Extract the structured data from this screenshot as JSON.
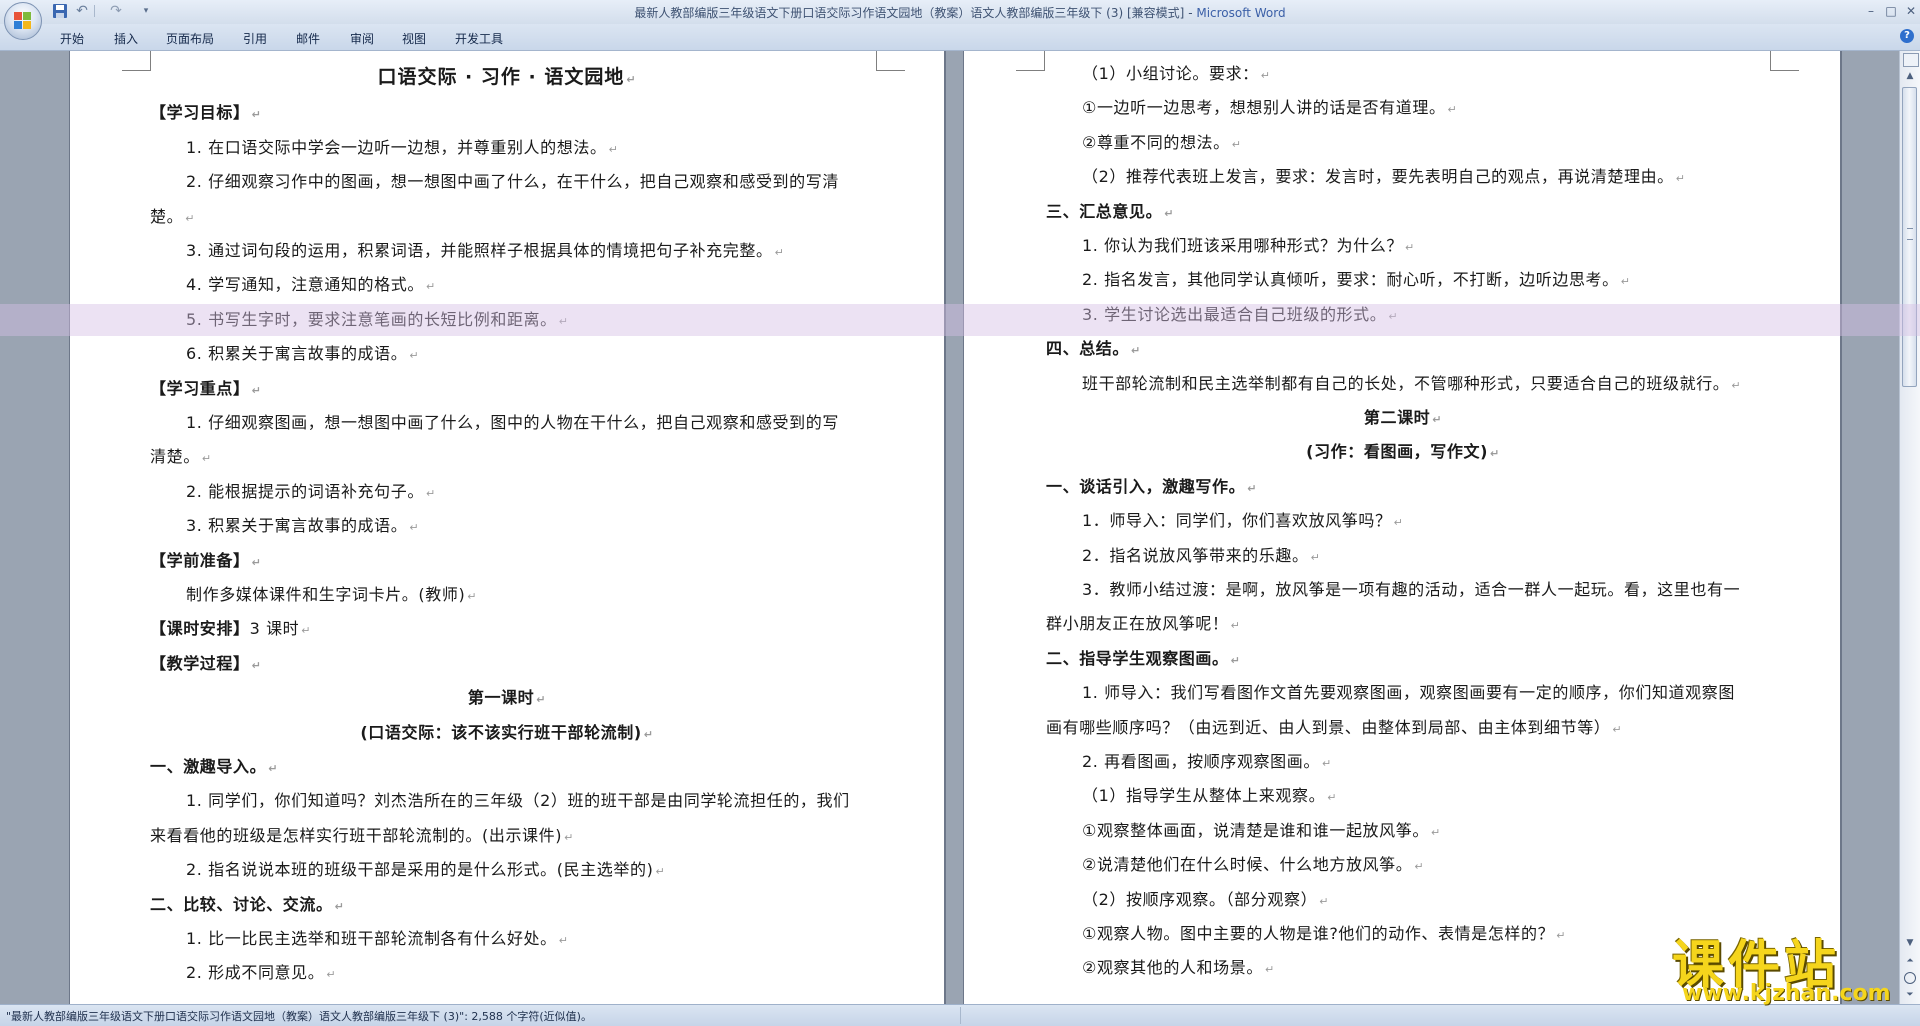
{
  "window": {
    "title": "最新人教部编版三年级语文下册口语交际习作语文园地（教案）语文人教部编版三年级下 (3) [兼容模式]",
    "app_name": "Microsoft Word"
  },
  "quick_access": {
    "save_icon": "save-icon",
    "undo_icon": "undo-icon",
    "redo_icon": "redo-icon",
    "customize_icon": "dropdown-arrow-icon"
  },
  "ribbon_tabs": [
    "开始",
    "插入",
    "页面布局",
    "引用",
    "邮件",
    "审阅",
    "视图",
    "开发工具"
  ],
  "colors": {
    "titlebar": "#dbe5f2",
    "title_app": "#3a5fa7",
    "page_bg": "#ffffff",
    "workspace": "#9aa4b2",
    "watermark": "#f5d51c"
  },
  "left_page": [
    {
      "t": "口语交际 · 习作 · 语文园地",
      "pm": "↵",
      "s": "title"
    },
    {
      "t": "【学习目标】",
      "pm": "↵",
      "s": "bold"
    },
    {
      "t": "1. 在口语交际中学会一边听一边想，并尊重别人的想法。",
      "pm": "↵",
      "s": "ind"
    },
    {
      "t": "2. 仔细观察习作中的图画，想一想图中画了什么，在干什么，把自己观察和感受到的写清",
      "pm": "",
      "s": "ind"
    },
    {
      "t": "楚。",
      "pm": "↵",
      "s": "plain"
    },
    {
      "t": "3. 通过词句段的运用，积累词语，并能照样子根据具体的情境把句子补充完整。",
      "pm": "↵",
      "s": "ind"
    },
    {
      "t": "4. 学写通知，注意通知的格式。",
      "pm": "↵",
      "s": "ind"
    },
    {
      "t": "5. 书写生字时，要求注意笔画的长短比例和距离。",
      "pm": "↵",
      "s": "ind"
    },
    {
      "t": "6. 积累关于寓言故事的成语。",
      "pm": "↵",
      "s": "ind"
    },
    {
      "t": "【学习重点】",
      "pm": "↵",
      "s": "bold"
    },
    {
      "t": "1. 仔细观察图画，想一想图中画了什么，图中的人物在干什么，把自己观察和感受到的写",
      "pm": "",
      "s": "ind"
    },
    {
      "t": "清楚。",
      "pm": "↵",
      "s": "plain"
    },
    {
      "t": "2. 能根据提示的词语补充句子。",
      "pm": "↵",
      "s": "ind"
    },
    {
      "t": "3. 积累关于寓言故事的成语。",
      "pm": "↵",
      "s": "ind"
    },
    {
      "t": "【学前准备】",
      "pm": "↵",
      "s": "bold"
    },
    {
      "t": "制作多媒体课件和生字词卡片。(教师)",
      "pm": "↵",
      "s": "ind"
    },
    {
      "t": "【课时安排】",
      "t2": "3 课时",
      "pm": "↵",
      "s": "mixed"
    },
    {
      "t": "【教学过程】",
      "pm": "↵",
      "s": "bold"
    },
    {
      "t": "第一课时",
      "pm": "↵",
      "s": "center-bold"
    },
    {
      "t": "(口语交际：该不该实行班干部轮流制)",
      "pm": "↵",
      "s": "center-bold"
    },
    {
      "t": "一、激趣导入。",
      "pm": "↵",
      "s": "bold"
    },
    {
      "t": "1. 同学们，你们知道吗？刘杰浩所在的三年级（2）班的班干部是由同学轮流担任的，我们",
      "pm": "",
      "s": "ind"
    },
    {
      "t": "来看看他的班级是怎样实行班干部轮流制的。(出示课件)",
      "pm": "↵",
      "s": "plain"
    },
    {
      "t": "2. 指名说说本班的班级干部是采用的是什么形式。(民主选举的)",
      "pm": "↵",
      "s": "ind"
    },
    {
      "t": "二、比较、讨论、交流。",
      "pm": "↵",
      "s": "bold"
    },
    {
      "t": "1. 比一比民主选举和班干部轮流制各有什么好处。",
      "pm": "↵",
      "s": "ind"
    },
    {
      "t": "2. 形成不同意见。",
      "pm": "↵",
      "s": "ind"
    }
  ],
  "right_page": [
    {
      "t": "（1）小组讨论。要求：",
      "pm": "↵",
      "s": "ind"
    },
    {
      "t": "①一边听一边思考，想想别人讲的话是否有道理。",
      "pm": "↵",
      "s": "ind"
    },
    {
      "t": "②尊重不同的想法。",
      "pm": "↵",
      "s": "ind"
    },
    {
      "t": "（2）推荐代表班上发言，要求：发言时，要先表明自己的观点，再说清楚理由。",
      "pm": "↵",
      "s": "ind"
    },
    {
      "t": "三、汇总意见。",
      "pm": "↵",
      "s": "bold"
    },
    {
      "t": "1. 你认为我们班该采用哪种形式？为什么？",
      "pm": "↵",
      "s": "ind"
    },
    {
      "t": "2. 指名发言，其他同学认真倾听，要求：耐心听，不打断，边听边思考。",
      "pm": "↵",
      "s": "ind"
    },
    {
      "t": "3. 学生讨论选出最适合自己班级的形式。",
      "pm": "↵",
      "s": "ind"
    },
    {
      "t": "四、总结。",
      "pm": "↵",
      "s": "bold"
    },
    {
      "t": "班干部轮流制和民主选举制都有自己的长处，不管哪种形式，只要适合自己的班级就行。",
      "pm": "↵",
      "s": "ind"
    },
    {
      "t": "第二课时",
      "pm": "↵",
      "s": "center-bold"
    },
    {
      "t": "(习作：看图画，写作文)",
      "pm": "↵",
      "s": "center-bold"
    },
    {
      "t": "一、谈话引入，激趣写作。",
      "pm": "↵",
      "s": "bold"
    },
    {
      "t": "1．师导入：同学们，你们喜欢放风筝吗？",
      "pm": "↵",
      "s": "ind"
    },
    {
      "t": "2．指名说放风筝带来的乐趣。",
      "pm": "↵",
      "s": "ind"
    },
    {
      "t": "3．教师小结过渡：是啊，放风筝是一项有趣的活动，适合一群人一起玩。看，这里也有一",
      "pm": "",
      "s": "ind"
    },
    {
      "t": "群小朋友正在放风筝呢！",
      "pm": "↵",
      "s": "plain"
    },
    {
      "t": "二、指导学生观察图画。",
      "pm": "↵",
      "s": "bold"
    },
    {
      "t": "1. 师导入：我们写看图作文首先要观察图画，观察图画要有一定的顺序，你们知道观察图",
      "pm": "",
      "s": "ind"
    },
    {
      "t": "画有哪些顺序吗？（由远到近、由人到景、由整体到局部、由主体到细节等）",
      "pm": "↵",
      "s": "plain"
    },
    {
      "t": "2. 再看图画，按顺序观察图画。",
      "pm": "↵",
      "s": "ind"
    },
    {
      "t": "（1）指导学生从整体上来观察。",
      "pm": "↵",
      "s": "ind"
    },
    {
      "t": "①观察整体画面，说清楚是谁和谁一起放风筝。",
      "pm": "↵",
      "s": "ind"
    },
    {
      "t": "②说清楚他们在什么时候、什么地方放风筝。",
      "pm": "↵",
      "s": "ind"
    },
    {
      "t": "（2）按顺序观察。（部分观察）",
      "pm": "↵",
      "s": "ind"
    },
    {
      "t": "①观察人物。图中主要的人物是谁?他们的动作、表情是怎样的？",
      "pm": "↵",
      "s": "ind"
    },
    {
      "t": "②观察其他的人和场景。",
      "pm": "↵",
      "s": "ind"
    }
  ],
  "statusbar": {
    "text": "\"最新人教部编版三年级语文下册口语交际习作语文园地（教案）语文人教部编版三年级下 (3)\": 2,588 个字符(近似值)。"
  },
  "watermark": {
    "cn": "课件站",
    "url": "www.kjzhan.com"
  }
}
